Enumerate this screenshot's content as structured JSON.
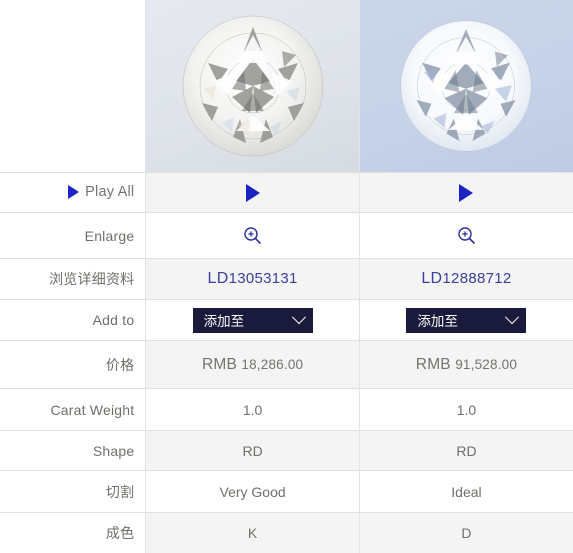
{
  "images": {
    "left": {
      "name": "diamond-photo-left",
      "bg": "#dfe3ea"
    },
    "right": {
      "name": "diamond-photo-right",
      "bg": "#c6d2e8"
    }
  },
  "rows": {
    "play_all": {
      "label": "Play All",
      "icon": "play-triangle-icon",
      "left_value": "",
      "right_value": ""
    },
    "enlarge": {
      "label": "Enlarge",
      "icon": "magnifier-plus-icon"
    },
    "detail": {
      "label": "浏览详细资料",
      "left_value": "LD13053131",
      "right_value": "LD12888712",
      "left_prefix": "LD",
      "left_number": "13053131",
      "right_prefix": "LD",
      "right_number": "12888712"
    },
    "add_to": {
      "label": "Add to",
      "button_label": "添加至",
      "chevron": "chevron-down-icon"
    },
    "price": {
      "label": "价格",
      "left_currency": "RMB",
      "left_amount": "18,286.00",
      "right_currency": "RMB",
      "right_amount": "91,528.00"
    },
    "carat_weight": {
      "label": "Carat Weight",
      "left_value": "1.0",
      "right_value": "1.0"
    },
    "shape": {
      "label": "Shape",
      "left_value": "RD",
      "right_value": "RD"
    },
    "cut": {
      "label": "切割",
      "left_value": "Very Good",
      "right_value": "Ideal"
    },
    "color": {
      "label": "成色",
      "left_value": "K",
      "right_value": "D"
    }
  },
  "colors": {
    "link": "#3c3f9e",
    "accent_blue": "#1a23c4",
    "dropdown_bg": "#1a1a3c",
    "shade_row": "#f4f4f4",
    "label_text": "#76746f"
  }
}
